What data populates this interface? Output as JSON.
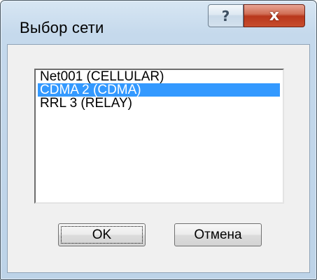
{
  "window": {
    "title": "Выбор сети",
    "help_symbol": "?",
    "close_symbol": "x"
  },
  "network_list": {
    "items": [
      {
        "label": "Net001 (CELLULAR)",
        "selected": false
      },
      {
        "label": "CDMA 2 (CDMA)",
        "selected": true
      },
      {
        "label": "RRL 3 (RELAY)",
        "selected": false
      }
    ]
  },
  "buttons": {
    "ok_label": "OK",
    "cancel_label": "Отмена"
  },
  "colors": {
    "selection": "#3399ff",
    "close_button": "#c84d2d",
    "frame": "#bdd3e8"
  }
}
